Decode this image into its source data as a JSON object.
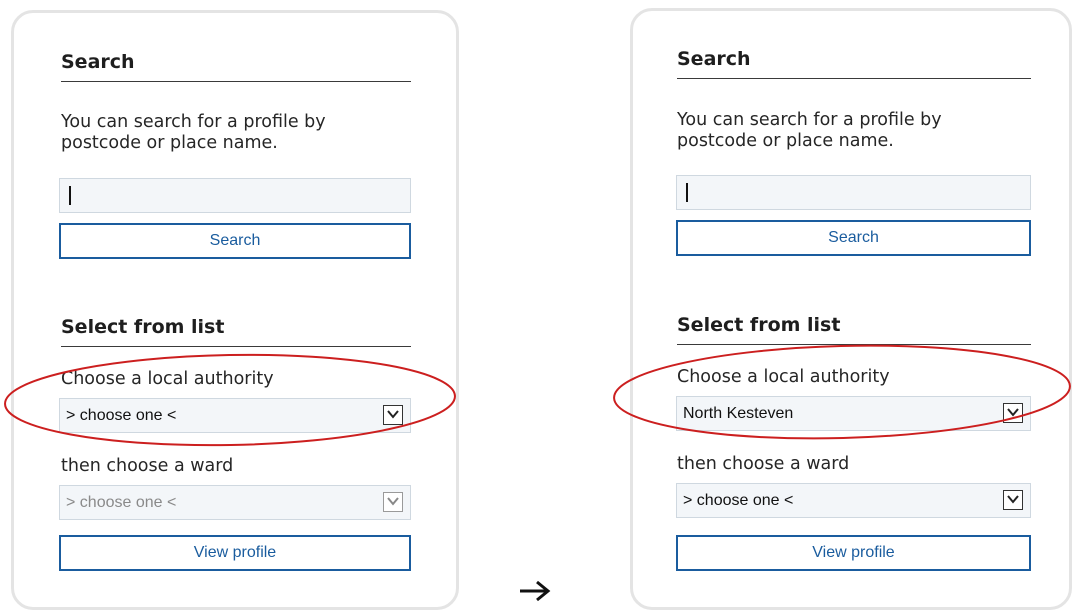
{
  "annotation": {
    "ellipse_color": "#cc1f1f",
    "arrow_glyph": "→"
  },
  "colors": {
    "button_border": "#1a5c9e",
    "input_bg": "#f3f6f9",
    "panel_border": "#e4e4e4"
  },
  "before": {
    "search_heading": "Search",
    "search_description": "You can search for a profile by postcode or place name.",
    "search_input_value": "",
    "search_button": "Search",
    "list_heading": "Select from list",
    "authority_label": "Choose a local authority",
    "authority_value": "> choose one <",
    "ward_label": "then choose a ward",
    "ward_value": "> choose one <",
    "ward_disabled": true,
    "view_button": "View profile"
  },
  "after": {
    "search_heading": "Search",
    "search_description": "You can search for a profile by postcode or place name.",
    "search_input_value": "",
    "search_button": "Search",
    "list_heading": "Select from list",
    "authority_label": "Choose a local authority",
    "authority_value": "North Kesteven",
    "ward_label": "then choose a ward",
    "ward_value": "> choose one <",
    "ward_disabled": false,
    "view_button": "View profile"
  }
}
